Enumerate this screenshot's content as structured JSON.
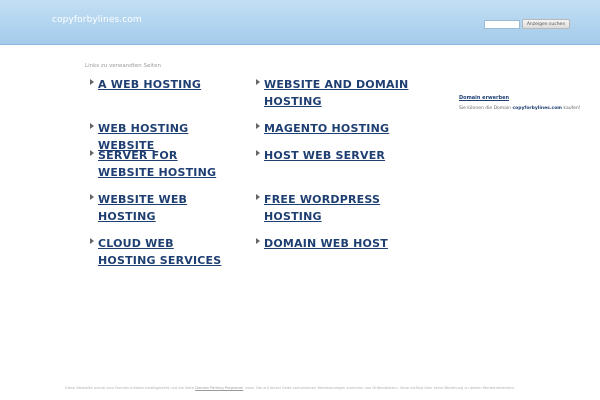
{
  "header": {
    "site_name": "copyforbylines.com",
    "search_placeholder": "",
    "search_button_label": "Anzeigen suchen"
  },
  "main": {
    "links_label": "Links zu verwandten Seiten",
    "links": [
      {
        "label": "A WEB HOSTING"
      },
      {
        "label": "WEBSITE AND DOMAIN HOSTING"
      },
      {
        "label": "WEB HOSTING WEBSITE"
      },
      {
        "label": "MAGENTO HOSTING"
      },
      {
        "label": "SERVER FOR WEBSITE HOSTING"
      },
      {
        "label": "HOST WEB SERVER"
      },
      {
        "label": "WEBSITE WEB HOSTING"
      },
      {
        "label": "FREE WORDPRESS HOSTING"
      },
      {
        "label": "CLOUD WEB HOSTING SERVICES"
      },
      {
        "label": "DOMAIN WEB HOST"
      }
    ]
  },
  "sidebar": {
    "title": "Domain erwerben",
    "text_before": "Sie können die Domain ",
    "domain": "copyforbylines.com",
    "text_after": " kaufen!"
  },
  "footer": {
    "text_part1": "Diese Webseite wurde vom Domain-Inhaber bereitgestellt und die Seite ",
    "link": "Domain Parking Programm",
    "text_part2": " nutzt. Die auf dieser Seite vorhandenen Werbeanzeigen stammen von Drittanbietern. Sedo verfügt über keine Beziehung zu diesen Werbetreibenden."
  }
}
